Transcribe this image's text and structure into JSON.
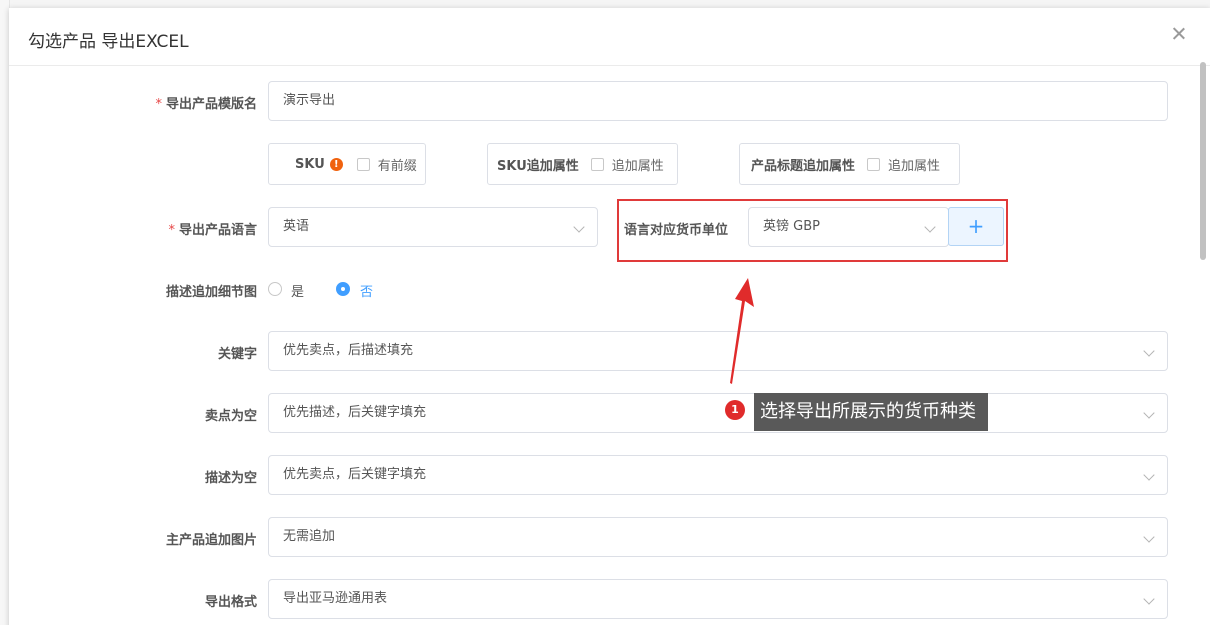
{
  "dialog": {
    "title": "勾选产品 导出EXCEL"
  },
  "form": {
    "template_name": {
      "label": "导出产品模版名",
      "required": true,
      "value": "演示导出"
    },
    "sku_option": {
      "label": "SKU",
      "checkbox_label": "有前缀"
    },
    "sku_attr_option": {
      "label": "SKU追加属性",
      "checkbox_label": "追加属性"
    },
    "title_attr_option": {
      "label": "产品标题追加属性",
      "checkbox_label": "追加属性"
    },
    "language": {
      "label": "导出产品语言",
      "required": true,
      "value": "英语"
    },
    "currency": {
      "label": "语言对应货币单位",
      "value": "英镑 GBP",
      "add_button": "+"
    },
    "detail_image": {
      "label": "描述追加细节图",
      "options": [
        "是",
        "否"
      ],
      "selected": "否"
    },
    "keywords": {
      "label": "关键字",
      "value": "优先卖点，后描述填充"
    },
    "selling_point_empty": {
      "label": "卖点为空",
      "value": "优先描述，后关键字填充"
    },
    "description_empty": {
      "label": "描述为空",
      "value": "优先卖点，后关键字填充"
    },
    "main_image": {
      "label": "主产品追加图片",
      "value": "无需追加"
    },
    "export_format": {
      "label": "导出格式",
      "value": "导出亚马逊通用表"
    }
  },
  "annotation": {
    "number": "1",
    "text": "选择导出所展示的货币种类",
    "color": "#e02b2b"
  },
  "colors": {
    "accent": "#409eff",
    "highlight_border": "#e03a3a",
    "warning": "#f0620e"
  }
}
